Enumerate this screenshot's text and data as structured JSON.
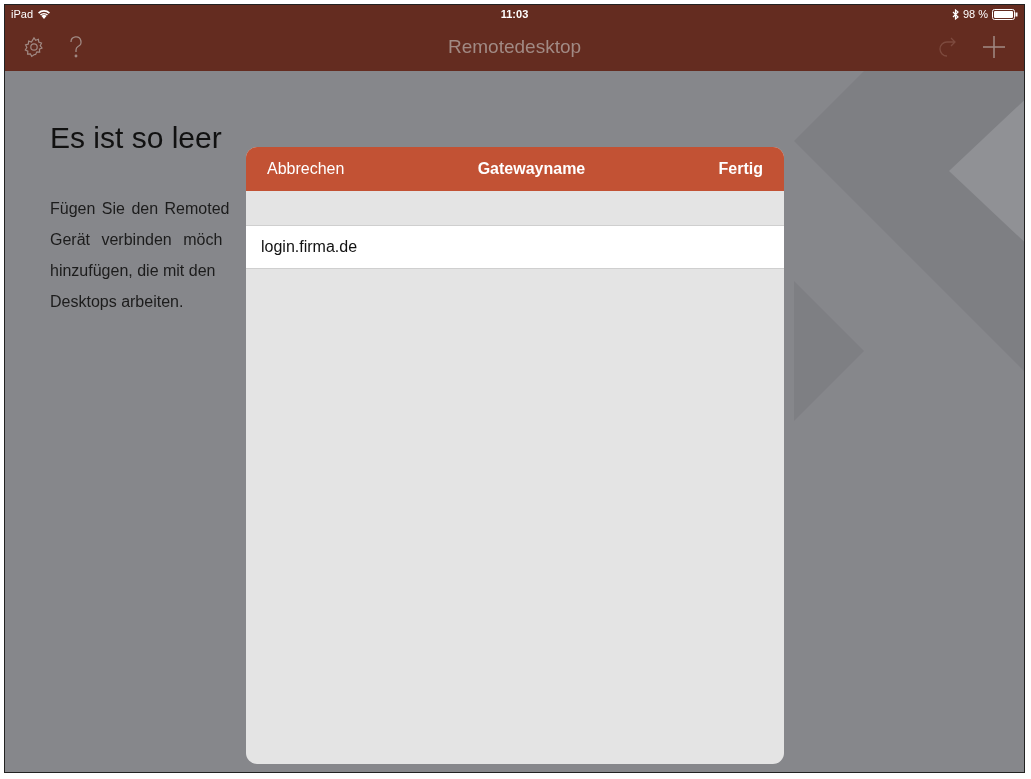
{
  "status_bar": {
    "device": "iPad",
    "time": "11:03",
    "battery": "98 %"
  },
  "nav_bar": {
    "title": "Remotedesktop"
  },
  "empty_state": {
    "heading": "Es ist so leer",
    "lines": [
      "Fügen Sie den Remoted",
      "Gerät verbinden möch",
      "hinzufügen, die mit den",
      "Desktops arbeiten."
    ]
  },
  "dialog": {
    "cancel": "Abbrechen",
    "title": "Gatewayname",
    "done": "Fertig",
    "field": {
      "value": "login.firma.de"
    }
  }
}
